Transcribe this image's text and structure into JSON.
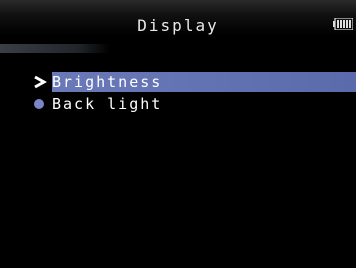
{
  "header": {
    "title": "Display",
    "battery_icon": "battery-icon"
  },
  "menu": {
    "items": [
      {
        "label": "Brightness",
        "selected": true,
        "marker_icon": "chevron-right-icon"
      },
      {
        "label": "Back light",
        "selected": false,
        "marker_icon": "bullet-dot-icon"
      }
    ]
  },
  "colors": {
    "selection": "#6a7ab9",
    "bullet": "#7a86c8",
    "text": "#ffffff",
    "background": "#000000"
  }
}
